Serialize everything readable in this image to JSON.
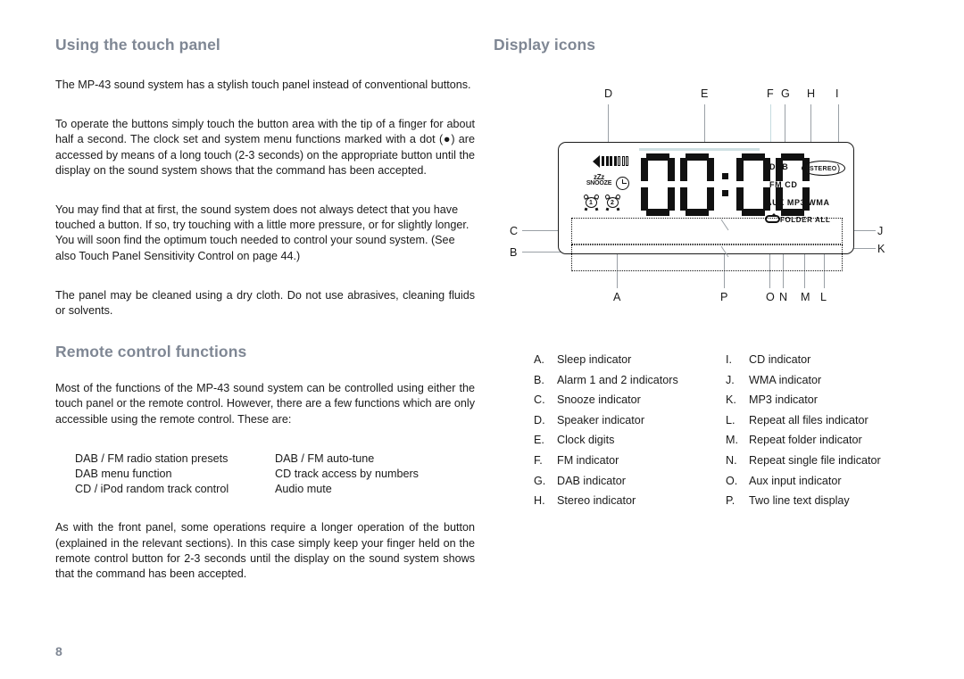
{
  "page_number": "8",
  "left_column": {
    "heading_1": "Using the touch panel",
    "paragraphs_1": [
      "The MP-43 sound system has a stylish touch panel instead of conventional buttons.",
      "To operate the buttons simply touch the button area with the tip of a finger for about half a second. The clock set and system menu functions marked with a dot (●) are accessed by means of a long touch (2-3 seconds) on the appropriate button until the display on the sound system shows that the command has been accepted.",
      "You may find that at first, the sound system does not always detect that you have touched a button. If so, try touching with a little more pressure, or for slightly longer. You will soon find the optimum touch needed to control your sound system. (See also Touch Panel Sensitivity Control on page 44.)",
      "The panel may be cleaned using a dry cloth. Do not use abrasives, cleaning fluids or solvents."
    ],
    "heading_2": "Remote control functions",
    "paragraph_intro": "Most of the functions of the MP-43 sound system can be controlled using either the touch panel or the remote control. However, there are a few functions which are only accessible using the remote control. These are:",
    "functions_col1": [
      "DAB / FM radio station presets",
      "DAB menu function",
      "CD / iPod random track control"
    ],
    "functions_col2": [
      "DAB / FM auto-tune",
      "CD track access by numbers",
      "Audio mute"
    ],
    "paragraph_outro": "As with the front panel, some operations require a longer operation of the button (explained in the relevant sections). In this case simply keep your finger held on the remote control button for 2-3 seconds until the display on the sound system shows that the command has been accepted."
  },
  "right_column": {
    "heading": "Display icons",
    "diagram": {
      "callouts_top": [
        "D",
        "E",
        "F",
        "G",
        "H",
        "I"
      ],
      "callouts_left": [
        "C",
        "B"
      ],
      "callouts_right": [
        "J",
        "K"
      ],
      "callouts_bottom": [
        "A",
        "P",
        "O",
        "N",
        "M",
        "L"
      ],
      "lcd": {
        "snooze_zzz": "zZz",
        "snooze_label": "SNOOZE",
        "alarm_1": "1",
        "alarm_2": "2",
        "clock_value": "00:00",
        "indicator_row_1": "DAB",
        "indicator_stereo": "STEREO",
        "indicator_row_2": "FM  CD",
        "indicator_row_3": "AUX  MP3  WMA",
        "indicator_row_4": "FOLDER  ALL"
      }
    },
    "legend_col1": [
      {
        "key": "A.",
        "label": "Sleep indicator"
      },
      {
        "key": "B.",
        "label": "Alarm 1 and 2 indicators"
      },
      {
        "key": "C.",
        "label": "Snooze indicator"
      },
      {
        "key": "D.",
        "label": "Speaker indicator"
      },
      {
        "key": "E.",
        "label": "Clock digits"
      },
      {
        "key": "F.",
        "label": "FM indicator"
      },
      {
        "key": "G.",
        "label": "DAB indicator"
      },
      {
        "key": "H.",
        "label": "Stereo indicator"
      }
    ],
    "legend_col2": [
      {
        "key": "I.",
        "label": "CD indicator"
      },
      {
        "key": "J.",
        "label": "WMA indicator"
      },
      {
        "key": "K.",
        "label": "MP3 indicator"
      },
      {
        "key": "L.",
        "label": "Repeat all files indicator"
      },
      {
        "key": "M.",
        "label": "Repeat folder indicator"
      },
      {
        "key": "N.",
        "label": "Repeat single file indicator"
      },
      {
        "key": "O.",
        "label": "Aux input indicator"
      },
      {
        "key": "P.",
        "label": "Two line text display"
      }
    ]
  },
  "colors": {
    "heading": "#7f8794",
    "body_text": "#1a1a1a",
    "leader_line": "#9aa0a6",
    "seg_bar": "#cfe0e3"
  }
}
